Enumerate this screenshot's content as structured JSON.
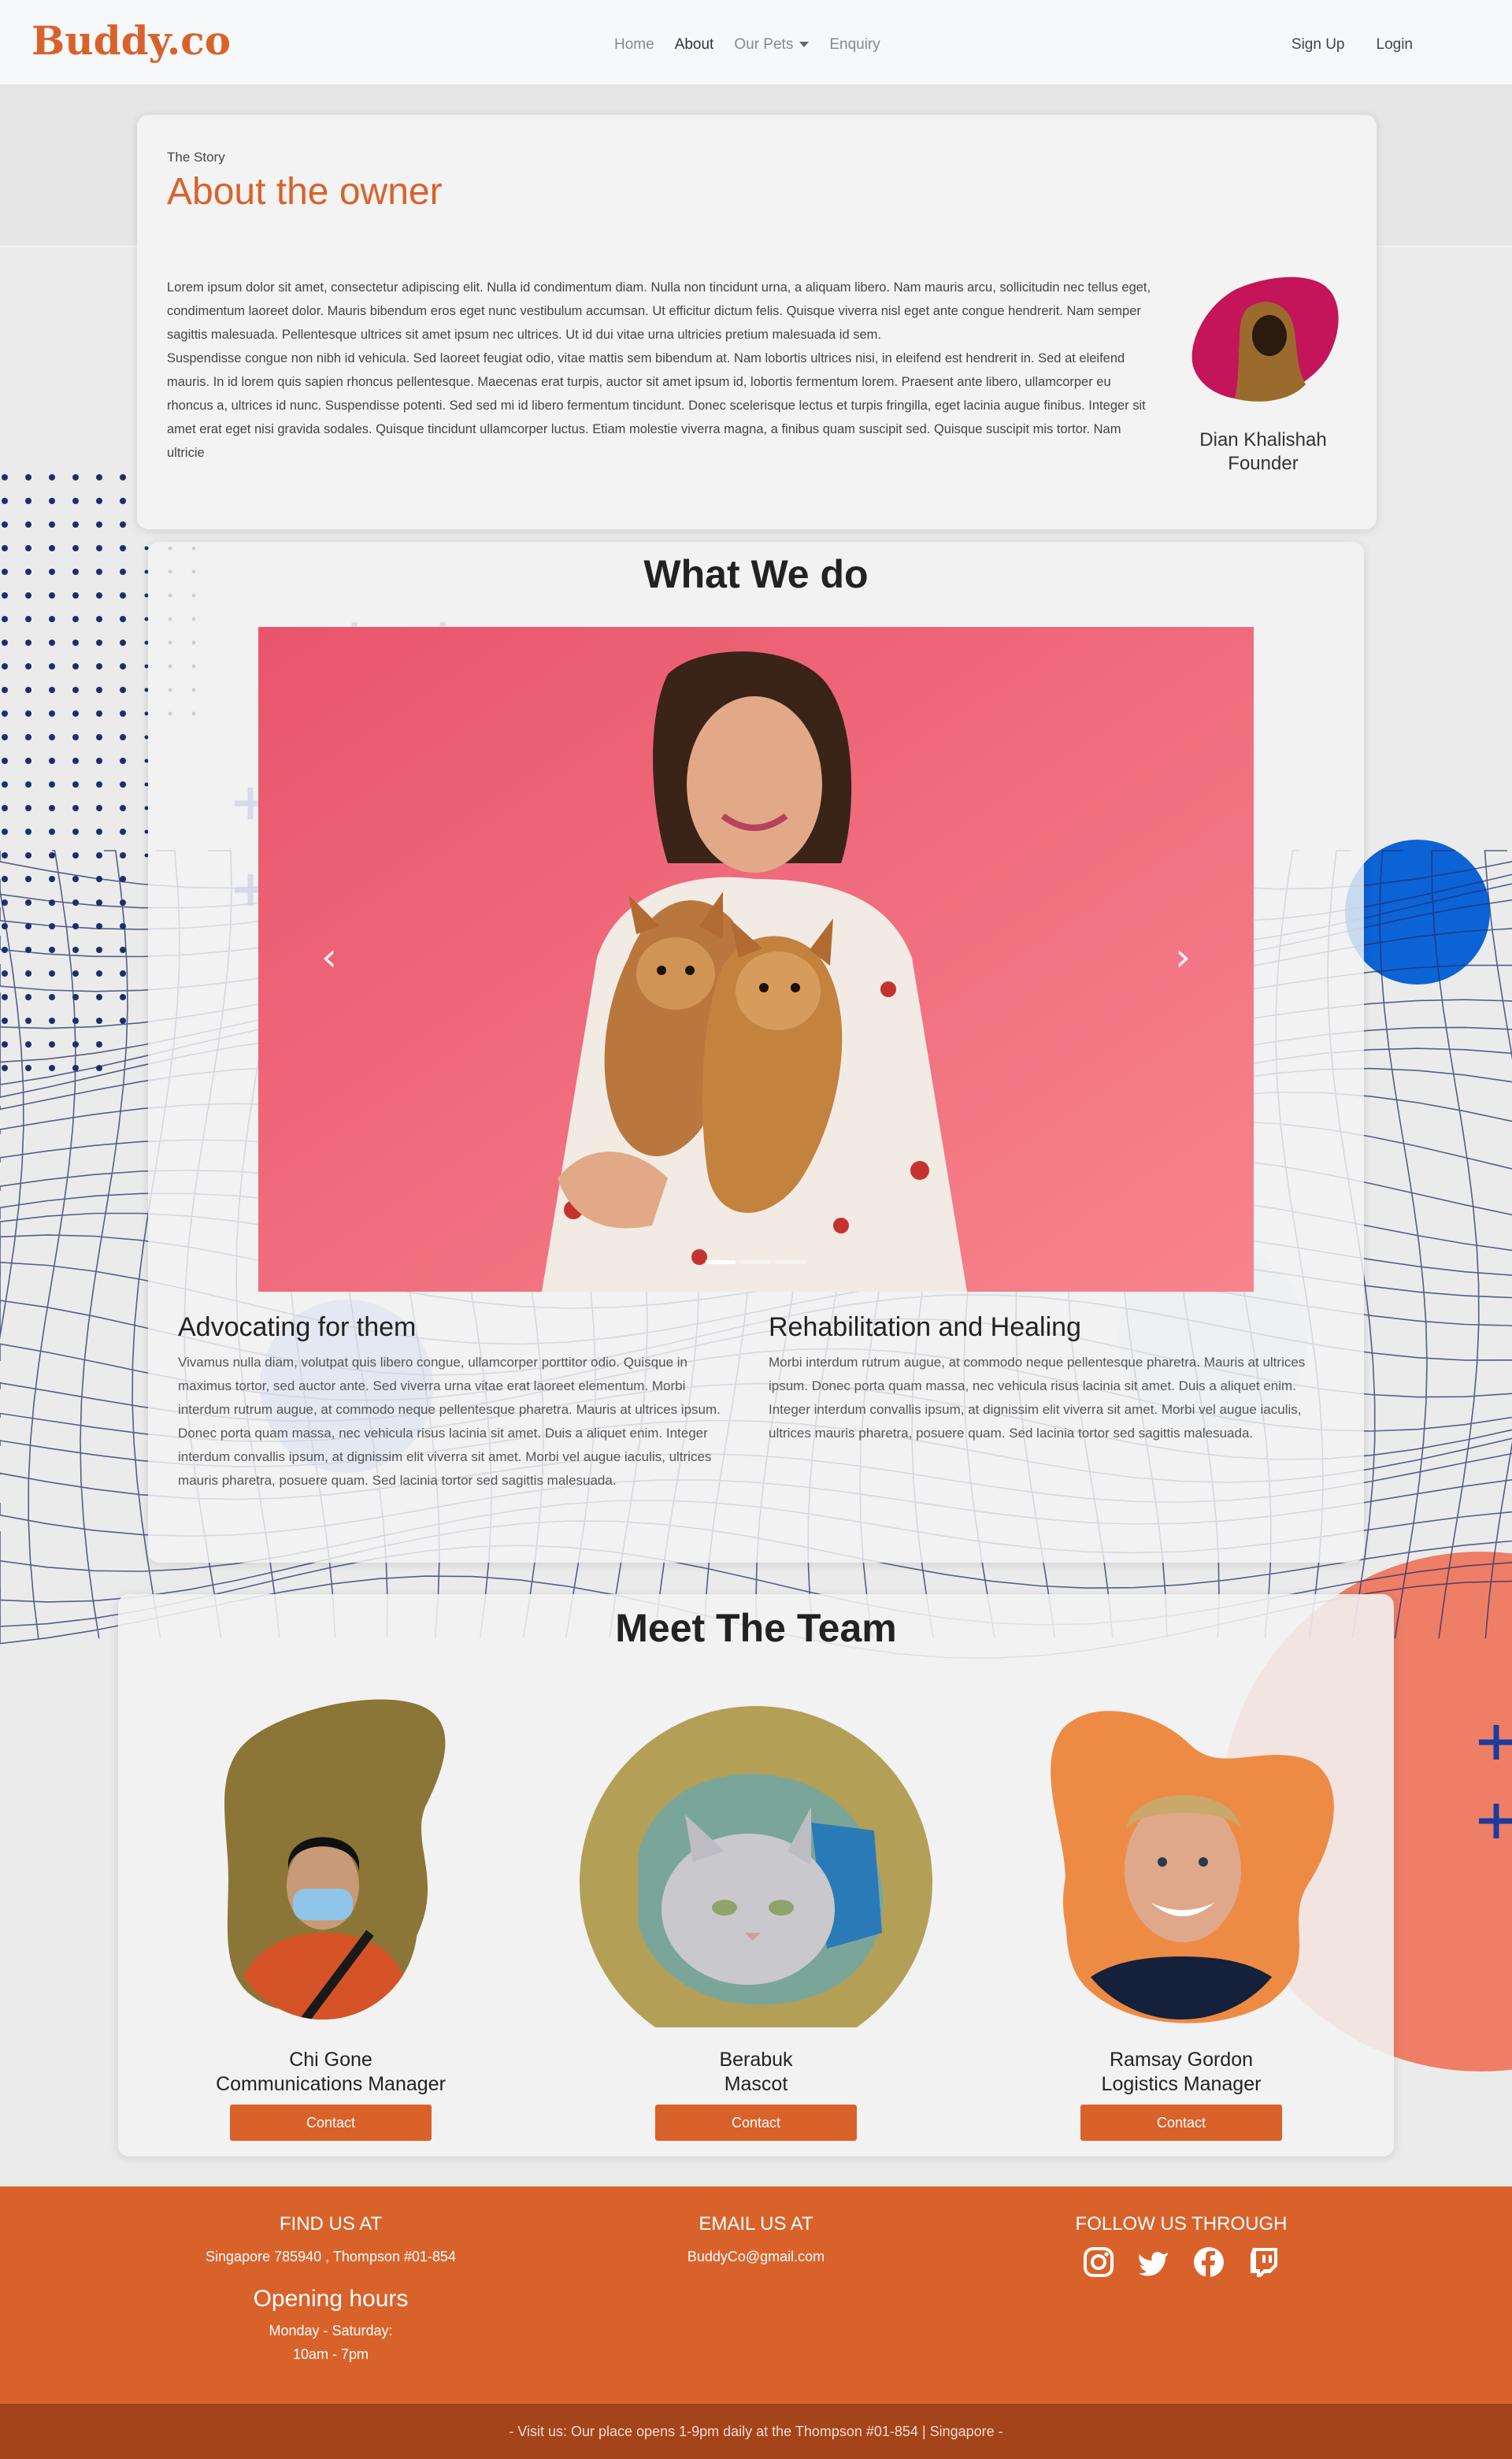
{
  "brand": "Buddy.co",
  "nav": {
    "home": "Home",
    "about": "About",
    "pets": "Our Pets",
    "enquiry": "Enquiry",
    "signup": "Sign Up",
    "login": "Login"
  },
  "about": {
    "kicker": "The Story",
    "title": "About the owner",
    "para1": "Lorem ipsum dolor sit amet, consectetur adipiscing elit. Nulla id condimentum diam. Nulla non tincidunt urna, a aliquam libero. Nam mauris arcu, sollicitudin nec tellus eget, condimentum laoreet dolor. Mauris bibendum eros eget nunc vestibulum accumsan. Ut efficitur dictum felis. Quisque viverra nisl eget ante congue hendrerit. Nam semper sagittis malesuada. Pellentesque ultrices sit amet ipsum nec ultrices. Ut id dui vitae urna ultricies pretium malesuada id sem.",
    "para2": "Suspendisse congue non nibh id vehicula. Sed laoreet feugiat odio, vitae mattis sem bibendum at. Nam lobortis ultrices nisi, in eleifend est hendrerit in. Sed at eleifend mauris. In id lorem quis sapien rhoncus pellentesque. Maecenas erat turpis, auctor sit amet ipsum id, lobortis fermentum lorem. Praesent ante libero, ullamcorper eu rhoncus a, ultrices id nunc. Suspendisse potenti. Sed sed mi id libero fermentum tincidunt. Donec scelerisque lectus et turpis fringilla, eget lacinia augue finibus. Integer sit amet erat eget nisi gravida sodales. Quisque tincidunt ullamcorper luctus. Etiam molestie viverra magna, a finibus quam suscipit sed. Quisque suscipit mis tortor. Nam ultricie",
    "owner_name": "Dian Khalishah",
    "owner_role": "Founder"
  },
  "whatwedo": {
    "title": "What We do",
    "carousel": {
      "prev": "‹",
      "next": "›"
    },
    "f1_title": "Advocating for them",
    "f1_text": "Vivamus nulla diam, volutpat quis libero congue, ullamcorper porttitor odio. Quisque in maximus tortor, sed auctor ante. Sed viverra urna vitae erat laoreet elementum. Morbi interdum rutrum augue, at commodo neque pellentesque pharetra. Mauris at ultrices ipsum. Donec porta quam massa, nec vehicula risus lacinia sit amet. Duis a aliquet enim. Integer interdum convallis ipsum, at dignissim elit viverra sit amet. Morbi vel augue iaculis, ultrices mauris pharetra, posuere quam. Sed lacinia tortor sed sagittis malesuada.",
    "f2_title": "Rehabilitation and Healing",
    "f2_text": "Morbi interdum rutrum augue, at commodo neque pellentesque pharetra. Mauris at ultrices ipsum. Donec porta quam massa, nec vehicula risus lacinia sit amet. Duis a aliquet enim. Integer interdum convallis ipsum, at dignissim elit viverra sit amet. Morbi vel augue iaculis, ultrices mauris pharetra, posuere quam. Sed lacinia tortor sed sagittis malesuada."
  },
  "team": {
    "title": "Meet The Team",
    "members": [
      {
        "name": "Chi Gone",
        "role": "Communications Manager",
        "button": "Contact"
      },
      {
        "name": "Berabuk",
        "role": "Mascot",
        "button": "Contact"
      },
      {
        "name": "Ramsay Gordon",
        "role": "Logistics Manager",
        "button": "Contact"
      }
    ]
  },
  "footer": {
    "find_title": "FIND US AT",
    "find_addr": "Singapore 785940 , Thompson #01-854",
    "hours_title": "Opening hours",
    "hours_days": "Monday - Saturday:",
    "hours_time": "10am - 7pm",
    "email_title": "EMAIL US AT",
    "email": "BuddyCo@gmail.com",
    "follow_title": "FOLLOW US THROUGH",
    "socials": [
      "instagram-icon",
      "twitter-icon",
      "facebook-icon",
      "twitch-icon"
    ],
    "bottom": "- Visit us: Our place opens 1-9pm daily at the Thompson #01-854 | Singapore -"
  },
  "colors": {
    "accent": "#d9622b",
    "footer_dark": "#a4441b"
  }
}
